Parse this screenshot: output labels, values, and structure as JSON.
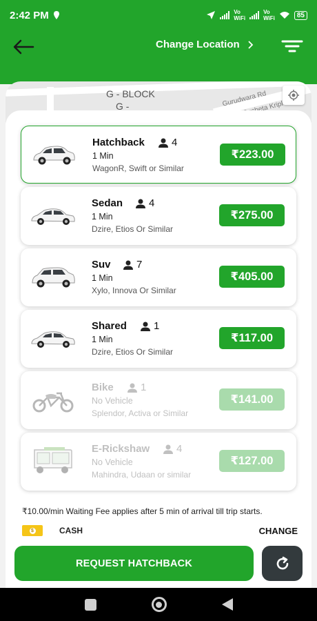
{
  "status_bar": {
    "time": "2:42 PM",
    "network1": "Vo\nWiFi",
    "network2": "Vo\nWiFi",
    "battery": "85"
  },
  "header": {
    "change_location_label": "Change Location",
    "back_icon": "arrow-left-icon",
    "filter_icon": "filter-menu-icon"
  },
  "map": {
    "labels": [
      "G - BLOCK",
      "G -",
      "Gurudwara Rd",
      "Sucheta Kripl"
    ]
  },
  "vehicles": [
    {
      "name": "Hatchback",
      "seats": "4",
      "eta": "1 Min",
      "desc": "WagonR, Swift or Similar",
      "price": "₹223.00",
      "selected": true,
      "available": true
    },
    {
      "name": "Sedan",
      "seats": "4",
      "eta": "1 Min",
      "desc": "Dzire, Etios Or Similar",
      "price": "₹275.00",
      "selected": false,
      "available": true
    },
    {
      "name": "Suv",
      "seats": "7",
      "eta": "1 Min",
      "desc": "Xylo, Innova Or Similar",
      "price": "₹405.00",
      "selected": false,
      "available": true
    },
    {
      "name": "Shared",
      "seats": "1",
      "eta": "1 Min",
      "desc": "Dzire, Etios Or Similar",
      "price": "₹117.00",
      "selected": false,
      "available": true
    },
    {
      "name": "Bike",
      "seats": "1",
      "eta": "No Vehicle",
      "desc": "Splendor, Activa or Similar",
      "price": "₹141.00",
      "selected": false,
      "available": false
    },
    {
      "name": "E-Rickshaw",
      "seats": "4",
      "eta": "No Vehicle",
      "desc": "Mahindra, Udaan or similar",
      "price": "₹127.00",
      "selected": false,
      "available": false
    }
  ],
  "waiting_note": "₹10.00/min Waiting Fee applies after 5 min of arrival till trip starts.",
  "payment": {
    "method": "CASH",
    "change_label": "CHANGE"
  },
  "request_button": "REQUEST HATCHBACK",
  "colors": {
    "brand_green": "#22a52b",
    "disabled_green": "#a9dbac",
    "dark_button": "#333a3d"
  }
}
